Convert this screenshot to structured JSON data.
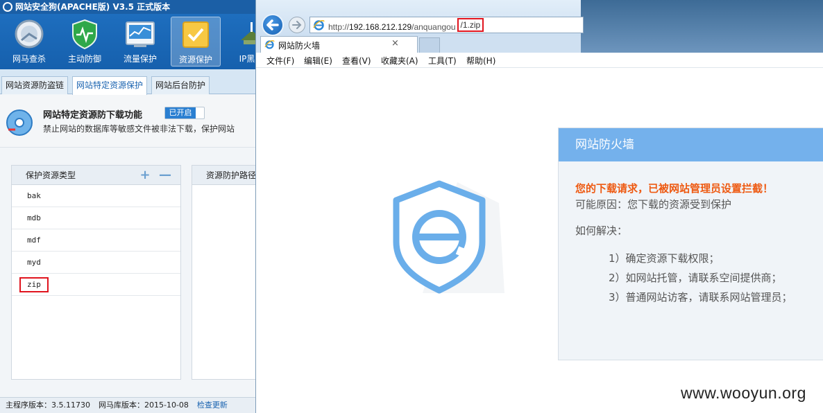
{
  "safedog": {
    "title": "网站安全狗(APACHE版) V3.5 正式版本",
    "toolbar": [
      {
        "label": "网马查杀",
        "icon": "scan-icon"
      },
      {
        "label": "主动防御",
        "icon": "shield-icon"
      },
      {
        "label": "流量保护",
        "icon": "traffic-chart-icon"
      },
      {
        "label": "资源保护",
        "icon": "folder-icon",
        "active": true
      },
      {
        "label": "IP黑白",
        "icon": "ip-icon"
      }
    ],
    "tabs": [
      "网站资源防盗链",
      "网站特定资源保护",
      "网站后台防护"
    ],
    "active_tab": 1,
    "feature": {
      "title": "网站特定资源防下载功能",
      "toggle_label": "已开启",
      "description": "禁止网站的数据库等敏感文件被非法下载，保护网站"
    },
    "panel": {
      "header": "保护资源类型",
      "add_symbol": "+",
      "remove_symbol": "—",
      "extensions": [
        "bak",
        "mdb",
        "mdf",
        "myd",
        "zip"
      ],
      "highlighted": "zip"
    },
    "panel2": {
      "header": "资源防护路径"
    },
    "status": {
      "main_version": "主程序版本：3.5.11730",
      "db_version": "网马库版本：2015-10-08",
      "update_link": "检查更新"
    }
  },
  "browser": {
    "url_prefix": "http://",
    "url_host": "192.168.212.129",
    "url_path": "/anquangou",
    "url_file": "/1.zip",
    "tab_title": "网站防火墙",
    "tab_close": "×",
    "menu": [
      "文件(F)",
      "编辑(E)",
      "查看(V)",
      "收藏夹(A)",
      "工具(T)",
      "帮助(H)"
    ],
    "firewall": {
      "header": "网站防火墙",
      "alert": "您的下载请求，已被网站管理员设置拦截！",
      "reason": "可能原因：您下载的资源受到保护",
      "how_to": "如何解决：",
      "steps": [
        "1）确定资源下载权限；",
        "2）如网站托管，请联系空间提供商；",
        "3）普通网站访客，请联系网站管理员；"
      ]
    }
  },
  "watermark": "www.wooyun.org",
  "colors": {
    "safedog_blue": "#1660ad",
    "highlight_red": "#e0141e",
    "alert_orange": "#ee5a12",
    "card_header": "#74b1ec"
  }
}
